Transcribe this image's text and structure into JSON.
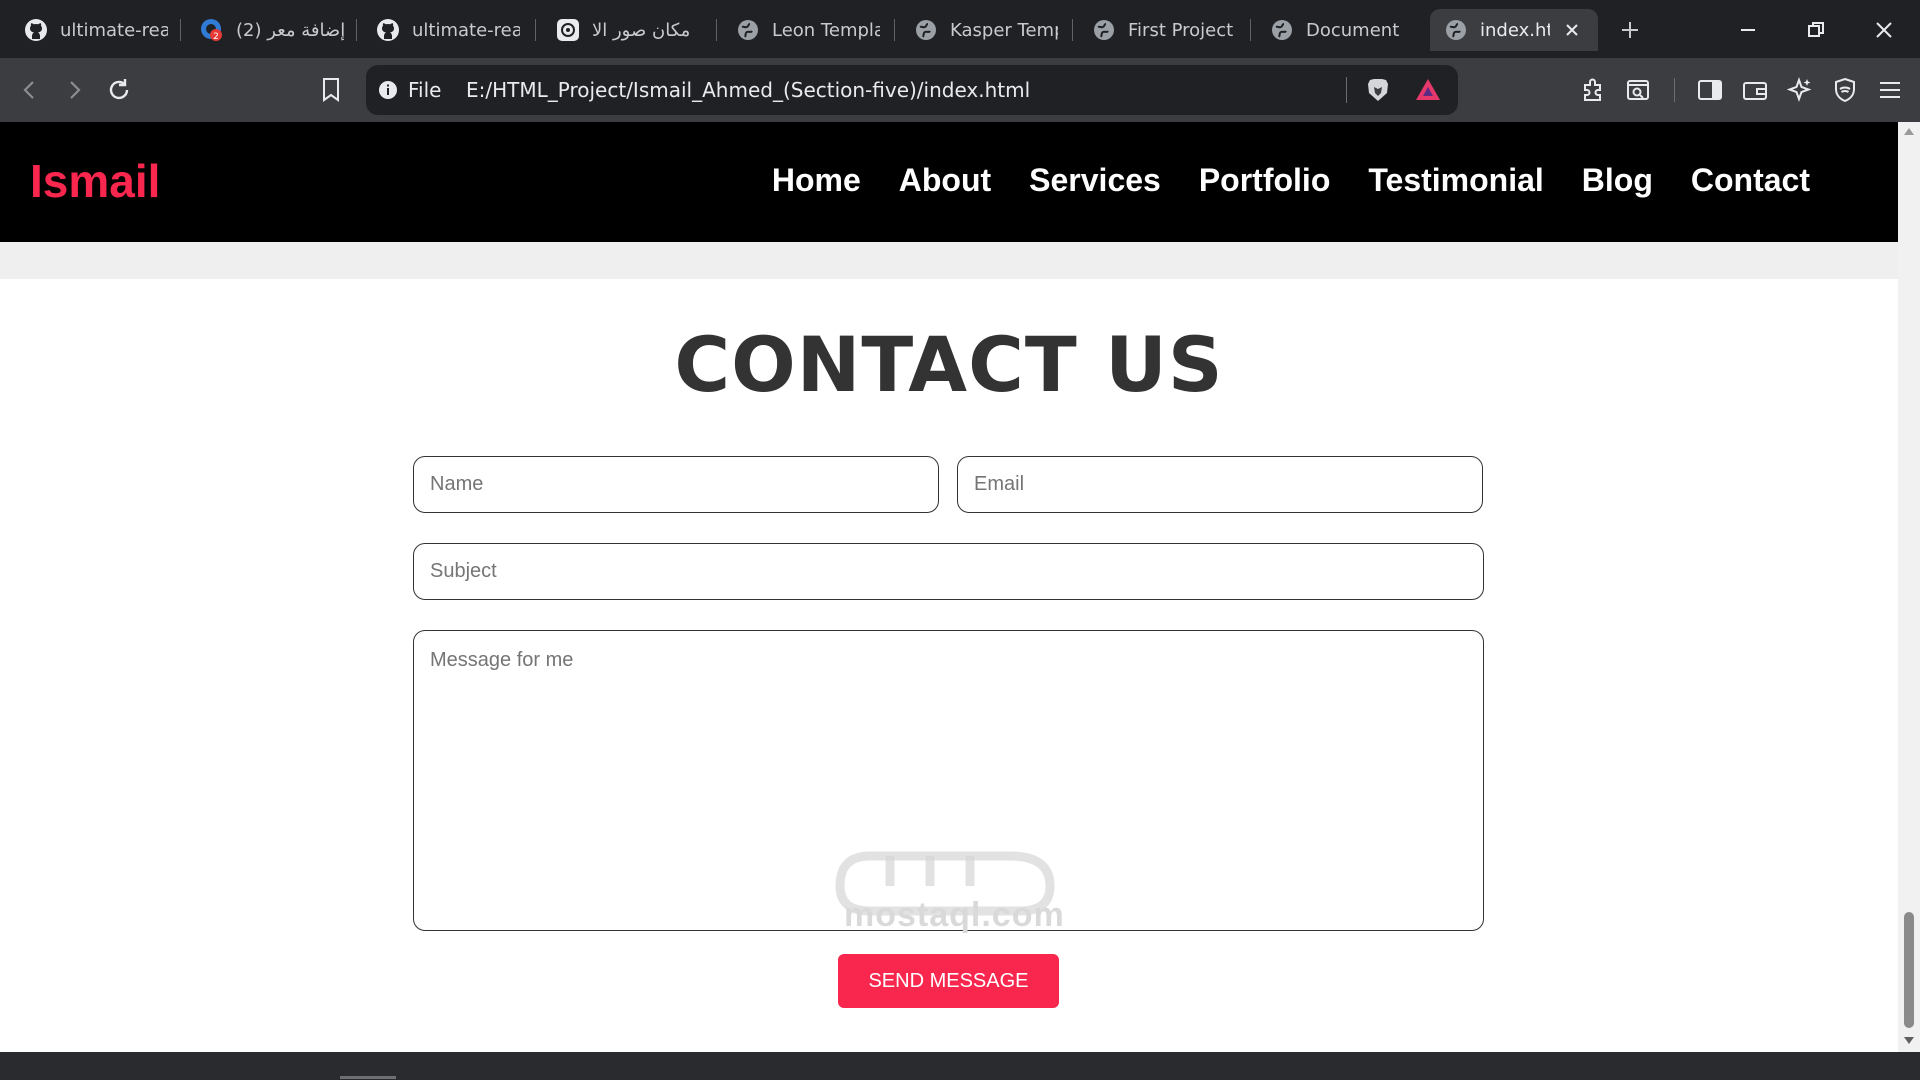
{
  "browser": {
    "tabs": [
      {
        "label": "ultimate-reac",
        "icon": "github-icon"
      },
      {
        "label": "(2) إضافة معر",
        "icon": "mostaql-icon",
        "badge": "2"
      },
      {
        "label": "ultimate-reac",
        "icon": "github-icon"
      },
      {
        "label": "مكان صور الا",
        "icon": "openai-icon"
      },
      {
        "label": "Leon Templat",
        "icon": "globe-icon"
      },
      {
        "label": "Kasper Temp",
        "icon": "globe-icon"
      },
      {
        "label": "First Project",
        "icon": "globe-icon"
      },
      {
        "label": "Document",
        "icon": "globe-icon"
      },
      {
        "label": "index.htr",
        "icon": "globe-icon",
        "active": true
      }
    ],
    "address": {
      "scheme_label": "File",
      "url": "E:/HTML_Project/Ismail_Ahmed_(Section-five)/index.html"
    }
  },
  "site": {
    "logo": "Ismail",
    "nav": [
      "Home",
      "About",
      "Services",
      "Portfolio",
      "Testimonial",
      "Blog",
      "Contact"
    ],
    "accent_color": "#f9264e"
  },
  "contact": {
    "title": "CONTACT US",
    "name_placeholder": "Name",
    "email_placeholder": "Email",
    "subject_placeholder": "Subject",
    "message_placeholder": "Message for me",
    "send_label": "SEND MESSAGE"
  },
  "watermark": {
    "text": "mostaql.com"
  }
}
